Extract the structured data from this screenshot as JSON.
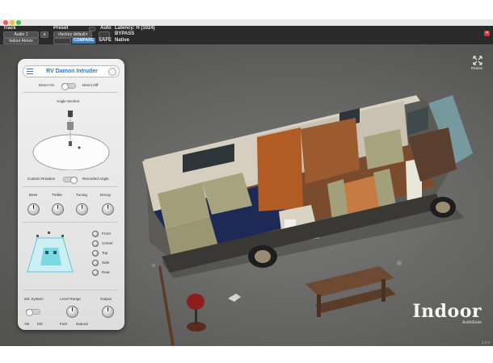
{
  "header": {
    "track_label": "Track",
    "preset_label": "Preset",
    "auto_label": "Auto",
    "latency_text": "Latency: H (1024)",
    "track_name": "Audio 1",
    "track_slot": "a",
    "preset_name": "<factory default>",
    "plugin_name": "Indoor Atmos",
    "compare_label": "COMPARE",
    "bypass_label": "BYPASS",
    "safe_label": "SAFE",
    "native_label": "Native"
  },
  "scene": {
    "resize_label": "Resize",
    "version": "1.0.0"
  },
  "logo": {
    "brand": "Indoor",
    "maker": "AudioEase"
  },
  "panel": {
    "room_name": "RV Damon Intruder",
    "direct_on": "Direct On",
    "direct_off": "Direct Off",
    "angle_section": "Angle Section",
    "custom_rotation": "Custom Rotation",
    "recorded_angle": "Recorded Angle",
    "knobs": [
      "Bass",
      "Treble",
      "Tuning",
      "Decay"
    ],
    "positions": [
      "Front",
      "Center",
      "Top",
      "Side",
      "Rear"
    ],
    "mic_system": "Mic System",
    "level_range": "Level Range",
    "output": "Output",
    "mic_left": "AB",
    "mic_right": "MS",
    "level_left": "Fast",
    "level_right": "Natural"
  }
}
